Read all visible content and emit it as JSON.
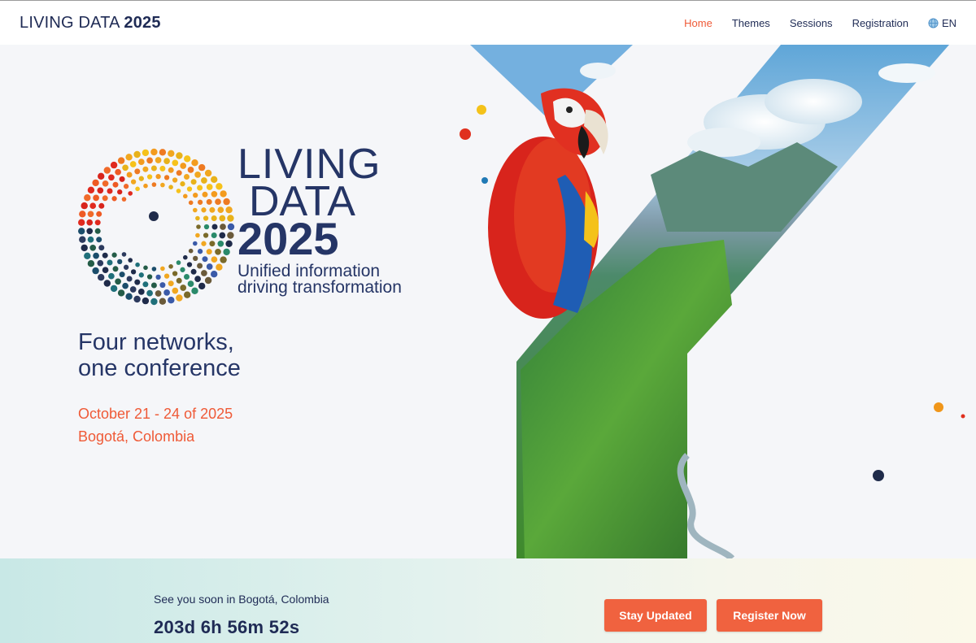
{
  "header": {
    "brand_light": "LIVING DATA",
    "brand_bold": "2025",
    "nav": [
      {
        "label": "Home",
        "active": true
      },
      {
        "label": "Themes",
        "active": false
      },
      {
        "label": "Sessions",
        "active": false
      },
      {
        "label": "Registration",
        "active": false
      }
    ],
    "language": "EN",
    "language_icon": "globe-icon"
  },
  "hero": {
    "logo": {
      "line1": "LIVING",
      "line2": "DATA",
      "line3": "2025",
      "subtitle_line1": "Unified information",
      "subtitle_line2": "driving transformation"
    },
    "tagline_line1": "Four networks,",
    "tagline_line2": "one conference",
    "dates": "October 21 - 24 of 2025",
    "location": "Bogotá, Colombia",
    "art_description_icons": [
      "macaw-image",
      "colombia-landscape-image"
    ]
  },
  "bottom": {
    "see_you": "See you soon in Bogotá, Colombia",
    "countdown": "203d 6h 56m 52s",
    "stay_updated": "Stay Updated",
    "register_now": "Register Now"
  },
  "colors": {
    "navy": "#1f2b55",
    "accent": "#ef5a37",
    "button": "#f0623f"
  }
}
